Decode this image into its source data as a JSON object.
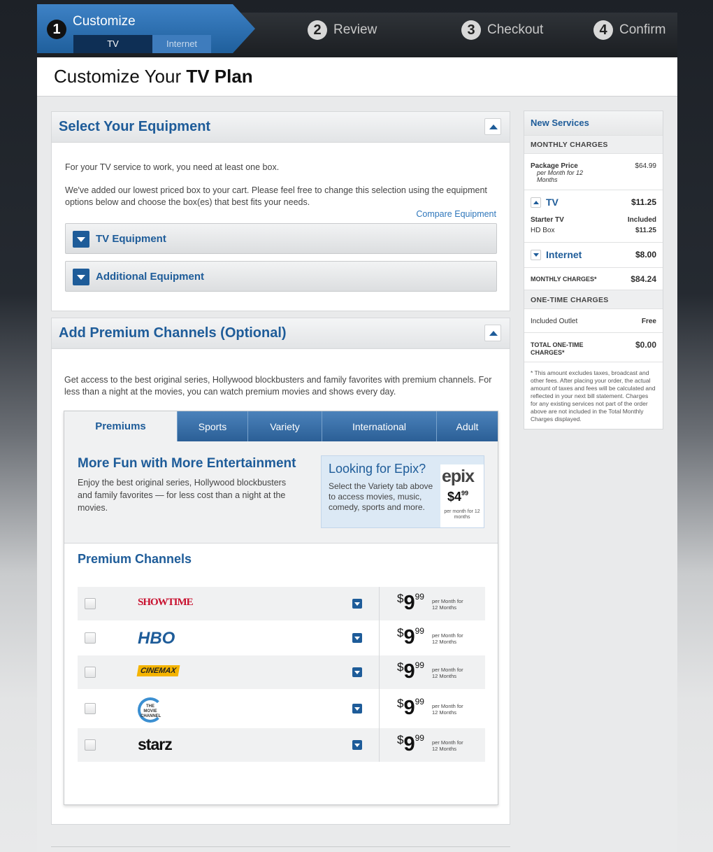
{
  "stepper": {
    "steps": [
      {
        "num": "1",
        "label": "Customize"
      },
      {
        "num": "2",
        "label": "Review"
      },
      {
        "num": "3",
        "label": "Checkout"
      },
      {
        "num": "4",
        "label": "Confirm"
      }
    ],
    "subtabs": {
      "tv": "TV",
      "internet": "Internet"
    }
  },
  "page": {
    "title_prefix": "Customize Your ",
    "title_bold": "TV Plan"
  },
  "equipment": {
    "title": "Select Your Equipment",
    "text1": "For your TV service to work, you need at least one box.",
    "text2": "We've added our lowest priced box to your cart. Please feel free to change this selection using the equipment options below and choose the box(es) that best fits your needs.",
    "compare_link": "Compare Equipment",
    "accordions": [
      "TV Equipment",
      "Additional Equipment"
    ]
  },
  "premium": {
    "title": "Add Premium Channels (Optional)",
    "intro": "Get access to the best original series, Hollywood blockbusters and family favorites with premium channels. For less than a night at the movies, you can watch premium movies and shows every day.",
    "tabs": [
      "Premiums",
      "Sports",
      "Variety",
      "International",
      "Adult"
    ],
    "feature_heading": "More Fun with More Entertainment",
    "feature_text": "Enjoy the best original series, Hollywood blockbusters and family favorites — for less cost than a night at the movies.",
    "epix": {
      "heading": "Looking for Epix?",
      "text": "Select the Variety tab above to access movies, music, comedy, sports and more.",
      "logo": "epix",
      "price_dollar": "$4",
      "price_cents": "99",
      "term": "per month for 12 months"
    },
    "channels_heading": "Premium Channels",
    "channels": [
      {
        "name": "SHOWTIME",
        "color": "#c8102e",
        "price_cur": "$",
        "price_big": "9",
        "price_cents": "99",
        "term": "per Month for 12 Months"
      },
      {
        "name": "HBO",
        "color": "#1e5c99",
        "price_cur": "$",
        "price_big": "9",
        "price_cents": "99",
        "term": "per Month for 12 Months"
      },
      {
        "name": "CINEMAX",
        "color": "#f5b400",
        "price_cur": "$",
        "price_big": "9",
        "price_cents": "99",
        "term": "per Month for 12 Months"
      },
      {
        "name": "THE MOVIE CHANNEL",
        "color": "#1e5c99",
        "price_cur": "$",
        "price_big": "9",
        "price_cents": "99",
        "term": "per Month for 12 Months"
      },
      {
        "name": "starz",
        "color": "#111111",
        "price_cur": "$",
        "price_big": "9",
        "price_cents": "99",
        "term": "per Month for 12 Months"
      }
    ]
  },
  "sidebar": {
    "title": "New Services",
    "monthly_header": "MONTHLY CHARGES",
    "package_label": "Package Price",
    "package_sub": "per Month for 12 Months",
    "package_value": "$64.99",
    "tv_label": "TV",
    "tv_value": "$11.25",
    "starter_label": "Starter TV",
    "starter_value": "Included",
    "hdbox_label": "HD Box",
    "hdbox_value": "$11.25",
    "internet_label": "Internet",
    "internet_value": "$8.00",
    "monthly_total_label": "MONTHLY CHARGES*",
    "monthly_total_value": "$84.24",
    "onetime_header": "ONE-TIME CHARGES",
    "outlet_label": "Included Outlet",
    "outlet_value": "Free",
    "onetime_total_label": "TOTAL ONE-TIME CHARGES*",
    "onetime_total_value": "$0.00",
    "note": "* This amount excludes taxes, broadcast and other fees. After placing your order, the actual amount of taxes and fees will be calculated and reflected in your next bill statement. Charges for any existing services not part of the order above are not included in the Total Monthly Charges displayed."
  }
}
